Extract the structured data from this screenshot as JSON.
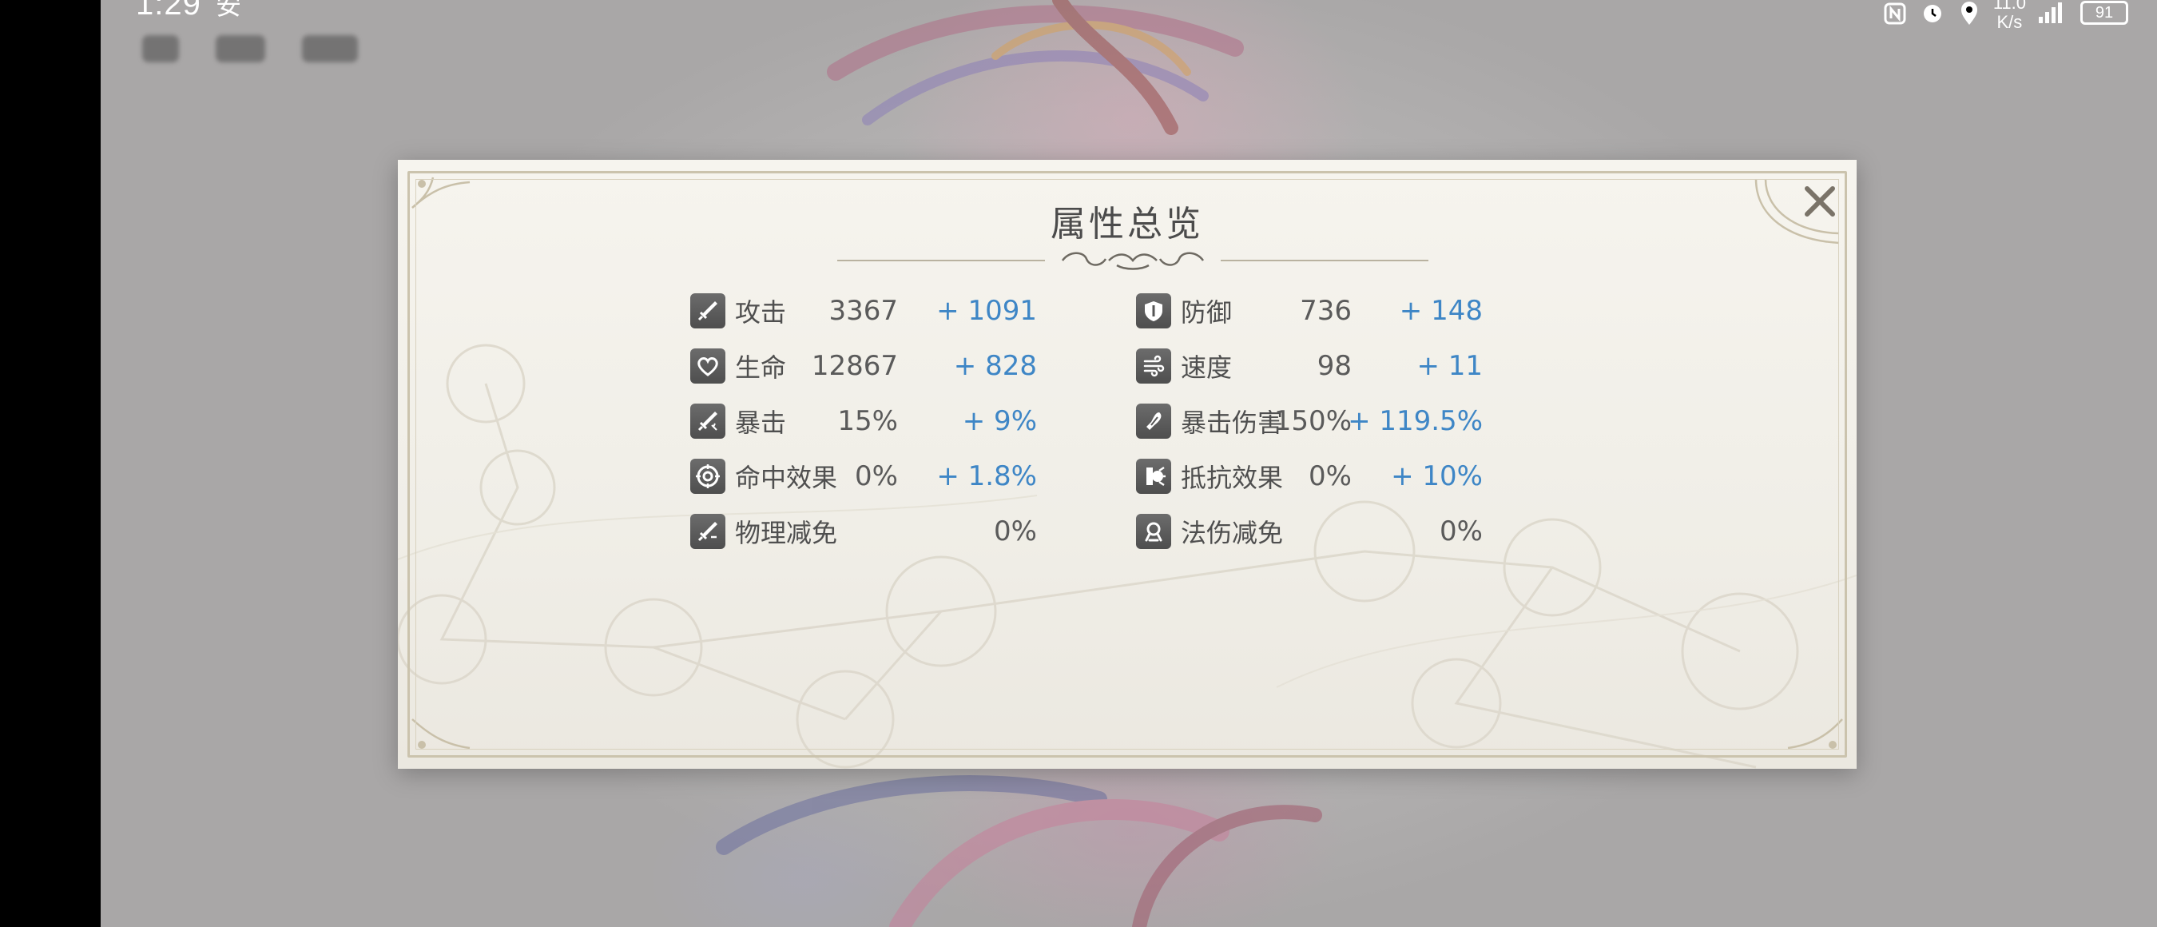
{
  "status_bar": {
    "time": "1:29",
    "time_suffix": "安",
    "net_speed_top": "11.0",
    "net_speed_bottom": "K/s",
    "battery": "91"
  },
  "panel": {
    "title": "属性总览",
    "close_icon": "close-x"
  },
  "stats": {
    "left": [
      {
        "label": "攻击",
        "base": "3367",
        "bonus": "+ 1091",
        "icon": "sword-icon"
      },
      {
        "label": "生命",
        "base": "12867",
        "bonus": "+ 828",
        "icon": "heart-icon"
      },
      {
        "label": "暴击",
        "base": "15%",
        "bonus": "+ 9%",
        "icon": "crit-sword-icon"
      },
      {
        "label": "命中效果",
        "base": "0%",
        "bonus": "+ 1.8%",
        "icon": "target-icon"
      },
      {
        "label": "物理减免",
        "base": "",
        "bonus": "0%",
        "icon": "physical-reduction-icon"
      }
    ],
    "right": [
      {
        "label": "防御",
        "base": "736",
        "bonus": "+ 148",
        "icon": "shield-icon"
      },
      {
        "label": "速度",
        "base": "98",
        "bonus": "+ 11",
        "icon": "wind-icon"
      },
      {
        "label": "暴击伤害",
        "base": "150%",
        "bonus": "+ 119.5%",
        "icon": "crit-damage-icon"
      },
      {
        "label": "抵抗效果",
        "base": "0%",
        "bonus": "+ 10%",
        "icon": "resist-icon"
      },
      {
        "label": "法伤减免",
        "base": "",
        "bonus": "0%",
        "icon": "magic-reduction-icon"
      }
    ]
  },
  "colors": {
    "bonus": "#3e86c6",
    "text": "#4f4f4f",
    "panel_bg": "#f3f1ea",
    "frame": "#cbc3ad"
  }
}
